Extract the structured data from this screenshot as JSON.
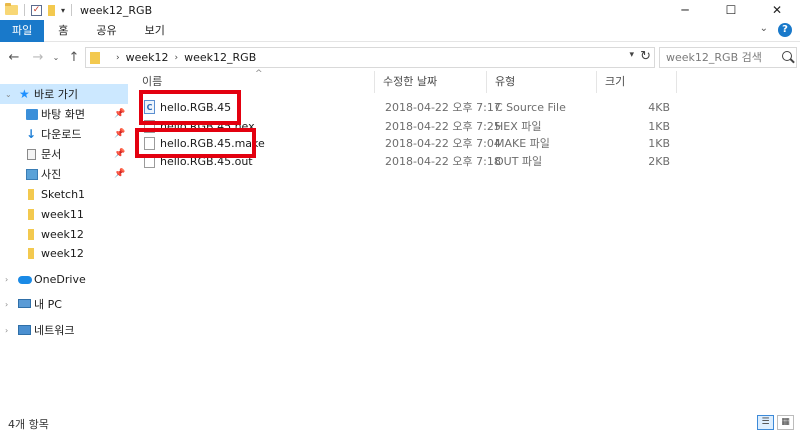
{
  "window": {
    "title": "week12_RGB",
    "controls": {
      "minimize": "─",
      "maximize": "☐",
      "close": "✕"
    }
  },
  "ribbon": {
    "tabs": [
      "파일",
      "홈",
      "공유",
      "보기"
    ],
    "help": "?"
  },
  "address": {
    "breadcrumbs": [
      "week12",
      "week12_RGB"
    ],
    "search_placeholder": "week12_RGB 검색"
  },
  "sidebar": {
    "quick_access": "바로 가기",
    "pinned": [
      "바탕 화면",
      "다운로드",
      "문서",
      "사진"
    ],
    "folders": [
      "Sketch1",
      "week11",
      "week12",
      "week12"
    ],
    "onedrive": "OneDrive",
    "this_pc": "내 PC",
    "network": "네트워크"
  },
  "columns": [
    "이름",
    "수정한 날짜",
    "유형",
    "크기"
  ],
  "files": [
    {
      "name": "hello.RGB.45",
      "date": "2018-04-22 오후 7:17",
      "type": "C Source File",
      "size": "4KB",
      "icon": "c-source-icon",
      "highlighted": true
    },
    {
      "name": "hello.RGB.45.hex",
      "date": "2018-04-22 오후 7:25",
      "type": "HEX 파일",
      "size": "1KB",
      "icon": "file-icon",
      "highlighted": false
    },
    {
      "name": "hello.RGB.45.make",
      "date": "2018-04-22 오후 7:04",
      "type": "MAKE 파일",
      "size": "1KB",
      "icon": "file-icon",
      "highlighted": true
    },
    {
      "name": "hello.RGB.45.out",
      "date": "2018-04-22 오후 7:18",
      "type": "OUT 파일",
      "size": "2KB",
      "icon": "file-icon",
      "highlighted": false
    }
  ],
  "status": {
    "item_count": "4개 항목"
  },
  "colors": {
    "accent": "#1979CA",
    "highlight_box": "#E3000F",
    "selection": "#CCE8FF"
  }
}
